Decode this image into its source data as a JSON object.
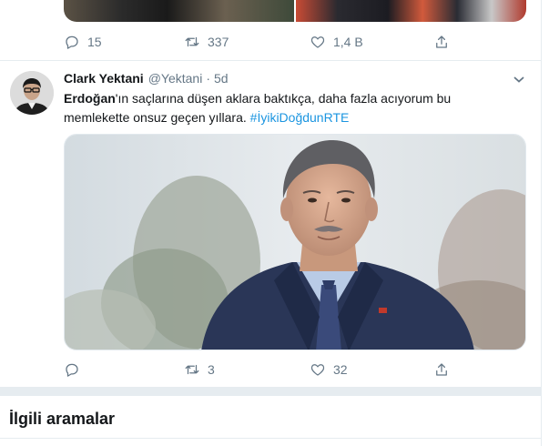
{
  "previous_tweet": {
    "stats": {
      "replies": "15",
      "retweets": "337",
      "likes": "1,4 B"
    }
  },
  "tweet": {
    "author_name": "Clark Yektani",
    "handle": "@Yektani",
    "separator": "·",
    "time": "5d",
    "text_bold": "Erdoğan",
    "text_rest": "'ın saçlarına düşen aklara baktıkça, daha fazla acıyorum bu memlekette onsuz geçen yıllara. ",
    "hashtag": "#İyikiDoğdunRTE",
    "stats": {
      "replies": "",
      "retweets": "3",
      "likes": "32"
    }
  },
  "related": {
    "title": "İlgili aramalar"
  },
  "icons": [
    "reply-icon",
    "retweet-icon",
    "like-icon",
    "share-icon",
    "chevron-down-icon"
  ],
  "colors": {
    "link": "#1b95e0",
    "muted": "#657786",
    "divider": "#e6ecf0"
  }
}
